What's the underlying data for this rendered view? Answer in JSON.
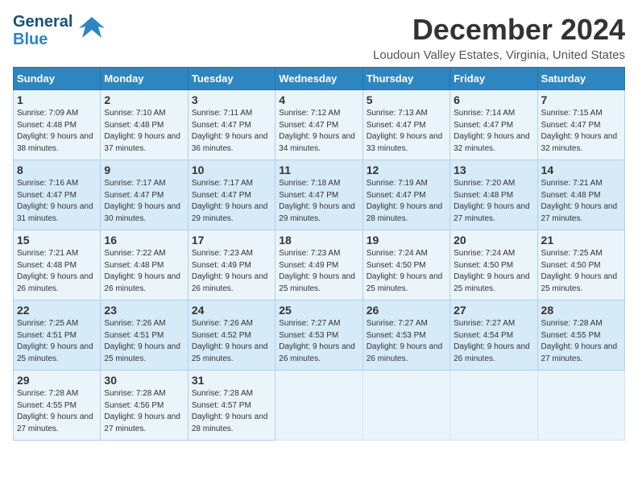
{
  "header": {
    "logo_line1": "General",
    "logo_line2": "Blue",
    "month_title": "December 2024",
    "subtitle": "Loudoun Valley Estates, Virginia, United States"
  },
  "days_of_week": [
    "Sunday",
    "Monday",
    "Tuesday",
    "Wednesday",
    "Thursday",
    "Friday",
    "Saturday"
  ],
  "weeks": [
    [
      {
        "num": "1",
        "sunrise": "7:09 AM",
        "sunset": "4:48 PM",
        "daylight": "9 hours and 38 minutes."
      },
      {
        "num": "2",
        "sunrise": "7:10 AM",
        "sunset": "4:48 PM",
        "daylight": "9 hours and 37 minutes."
      },
      {
        "num": "3",
        "sunrise": "7:11 AM",
        "sunset": "4:47 PM",
        "daylight": "9 hours and 36 minutes."
      },
      {
        "num": "4",
        "sunrise": "7:12 AM",
        "sunset": "4:47 PM",
        "daylight": "9 hours and 34 minutes."
      },
      {
        "num": "5",
        "sunrise": "7:13 AM",
        "sunset": "4:47 PM",
        "daylight": "9 hours and 33 minutes."
      },
      {
        "num": "6",
        "sunrise": "7:14 AM",
        "sunset": "4:47 PM",
        "daylight": "9 hours and 32 minutes."
      },
      {
        "num": "7",
        "sunrise": "7:15 AM",
        "sunset": "4:47 PM",
        "daylight": "9 hours and 32 minutes."
      }
    ],
    [
      {
        "num": "8",
        "sunrise": "7:16 AM",
        "sunset": "4:47 PM",
        "daylight": "9 hours and 31 minutes."
      },
      {
        "num": "9",
        "sunrise": "7:17 AM",
        "sunset": "4:47 PM",
        "daylight": "9 hours and 30 minutes."
      },
      {
        "num": "10",
        "sunrise": "7:17 AM",
        "sunset": "4:47 PM",
        "daylight": "9 hours and 29 minutes."
      },
      {
        "num": "11",
        "sunrise": "7:18 AM",
        "sunset": "4:47 PM",
        "daylight": "9 hours and 29 minutes."
      },
      {
        "num": "12",
        "sunrise": "7:19 AM",
        "sunset": "4:47 PM",
        "daylight": "9 hours and 28 minutes."
      },
      {
        "num": "13",
        "sunrise": "7:20 AM",
        "sunset": "4:48 PM",
        "daylight": "9 hours and 27 minutes."
      },
      {
        "num": "14",
        "sunrise": "7:21 AM",
        "sunset": "4:48 PM",
        "daylight": "9 hours and 27 minutes."
      }
    ],
    [
      {
        "num": "15",
        "sunrise": "7:21 AM",
        "sunset": "4:48 PM",
        "daylight": "9 hours and 26 minutes."
      },
      {
        "num": "16",
        "sunrise": "7:22 AM",
        "sunset": "4:48 PM",
        "daylight": "9 hours and 26 minutes."
      },
      {
        "num": "17",
        "sunrise": "7:23 AM",
        "sunset": "4:49 PM",
        "daylight": "9 hours and 26 minutes."
      },
      {
        "num": "18",
        "sunrise": "7:23 AM",
        "sunset": "4:49 PM",
        "daylight": "9 hours and 25 minutes."
      },
      {
        "num": "19",
        "sunrise": "7:24 AM",
        "sunset": "4:50 PM",
        "daylight": "9 hours and 25 minutes."
      },
      {
        "num": "20",
        "sunrise": "7:24 AM",
        "sunset": "4:50 PM",
        "daylight": "9 hours and 25 minutes."
      },
      {
        "num": "21",
        "sunrise": "7:25 AM",
        "sunset": "4:50 PM",
        "daylight": "9 hours and 25 minutes."
      }
    ],
    [
      {
        "num": "22",
        "sunrise": "7:25 AM",
        "sunset": "4:51 PM",
        "daylight": "9 hours and 25 minutes."
      },
      {
        "num": "23",
        "sunrise": "7:26 AM",
        "sunset": "4:51 PM",
        "daylight": "9 hours and 25 minutes."
      },
      {
        "num": "24",
        "sunrise": "7:26 AM",
        "sunset": "4:52 PM",
        "daylight": "9 hours and 25 minutes."
      },
      {
        "num": "25",
        "sunrise": "7:27 AM",
        "sunset": "4:53 PM",
        "daylight": "9 hours and 26 minutes."
      },
      {
        "num": "26",
        "sunrise": "7:27 AM",
        "sunset": "4:53 PM",
        "daylight": "9 hours and 26 minutes."
      },
      {
        "num": "27",
        "sunrise": "7:27 AM",
        "sunset": "4:54 PM",
        "daylight": "9 hours and 26 minutes."
      },
      {
        "num": "28",
        "sunrise": "7:28 AM",
        "sunset": "4:55 PM",
        "daylight": "9 hours and 27 minutes."
      }
    ],
    [
      {
        "num": "29",
        "sunrise": "7:28 AM",
        "sunset": "4:55 PM",
        "daylight": "9 hours and 27 minutes."
      },
      {
        "num": "30",
        "sunrise": "7:28 AM",
        "sunset": "4:56 PM",
        "daylight": "9 hours and 27 minutes."
      },
      {
        "num": "31",
        "sunrise": "7:28 AM",
        "sunset": "4:57 PM",
        "daylight": "9 hours and 28 minutes."
      },
      null,
      null,
      null,
      null
    ]
  ]
}
